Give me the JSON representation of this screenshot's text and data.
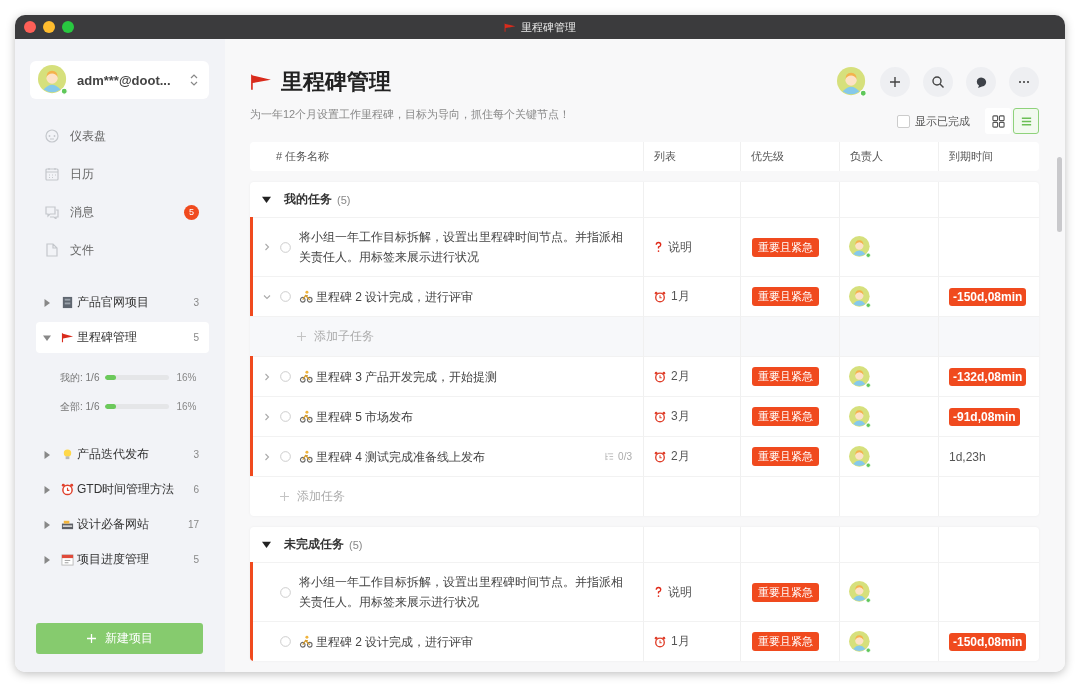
{
  "window": {
    "title": "里程碑管理"
  },
  "account": {
    "name": "adm***@doot..."
  },
  "nav": [
    {
      "label": "仪表盘"
    },
    {
      "label": "日历"
    },
    {
      "label": "消息",
      "badge": "5"
    },
    {
      "label": "文件"
    }
  ],
  "projects": [
    {
      "label": "产品官网项目",
      "count": "3",
      "expanded": false,
      "selected": false
    },
    {
      "label": "里程碑管理",
      "count": "5",
      "expanded": true,
      "selected": true,
      "progress": [
        {
          "label": "我的:",
          "fraction": "1/6",
          "level": 0.16,
          "percent": "16%"
        },
        {
          "label": "全部:",
          "fraction": "1/6",
          "level": 0.16,
          "percent": "16%"
        }
      ]
    },
    {
      "label": "产品迭代发布",
      "count": "3",
      "expanded": false,
      "selected": false
    },
    {
      "label": "GTD时间管理方法",
      "count": "6",
      "expanded": false,
      "selected": false
    },
    {
      "label": "设计必备网站",
      "count": "17",
      "expanded": false,
      "selected": false
    },
    {
      "label": "项目进度管理",
      "count": "5",
      "expanded": false,
      "selected": false
    }
  ],
  "new_project_button": {
    "label": "新建项目"
  },
  "page": {
    "title": "里程碑管理",
    "subtitle": "为一年12个月设置工作里程碑，目标为导向，抓住每个关键节点！",
    "show_completed": {
      "label": "显示已完成",
      "checked": false
    },
    "views": [
      {
        "selected": false
      },
      {
        "selected": true
      }
    ]
  },
  "table": {
    "columns": [
      "# 任务名称",
      "列表",
      "优先级",
      "负责人",
      "到期时间"
    ],
    "groups": [
      {
        "title": "我的任务",
        "count": "(5)",
        "expanded": true,
        "add_task": "添加任务",
        "tasks": [
          {
            "title": "将小组一年工作目标拆解，设置出里程碑时间节点。并指派相关责任人。用标签来展示进行状况",
            "kind": "note",
            "has_subtasks": true,
            "expanded": false,
            "flagged": true,
            "list": "说明",
            "priority": "重要且紧急"
          },
          {
            "title": "里程碑 2 设计完成，进行评审",
            "kind": "milestone",
            "has_subtasks": true,
            "expanded": true,
            "flagged": true,
            "list": "1月",
            "priority": "重要且紧急",
            "due": "-150d,08min",
            "overdue": true,
            "add_subtask": "添加子任务"
          },
          {
            "title": "里程碑 3 产品开发完成，开始提测",
            "kind": "milestone",
            "has_subtasks": true,
            "expanded": false,
            "flagged": true,
            "list": "2月",
            "priority": "重要且紧急",
            "due": "-132d,08min",
            "overdue": true
          },
          {
            "title": "里程碑 5 市场发布",
            "kind": "milestone",
            "has_subtasks": true,
            "expanded": false,
            "flagged": true,
            "list": "3月",
            "priority": "重要且紧急",
            "due": "-91d,08min",
            "overdue": true
          },
          {
            "title": "里程碑 4 测试完成准备线上发布",
            "kind": "milestone",
            "has_subtasks": true,
            "expanded": false,
            "flagged": true,
            "subtask_count": "0/3",
            "list": "2月",
            "priority": "重要且紧急",
            "due": "1d,23h",
            "overdue": false
          }
        ]
      },
      {
        "title": "未完成任务",
        "count": "(5)",
        "expanded": true,
        "tasks": [
          {
            "title": "将小组一年工作目标拆解，设置出里程碑时间节点。并指派相关责任人。用标签来展示进行状况",
            "kind": "note",
            "has_subtasks": false,
            "flagged": true,
            "list": "说明",
            "priority": "重要且紧急"
          },
          {
            "title": "里程碑 2 设计完成，进行评审",
            "kind": "milestone",
            "has_subtasks": false,
            "flagged": true,
            "list": "1月",
            "priority": "重要且紧急",
            "due": "-150d,08min",
            "overdue": true
          }
        ]
      }
    ]
  }
}
